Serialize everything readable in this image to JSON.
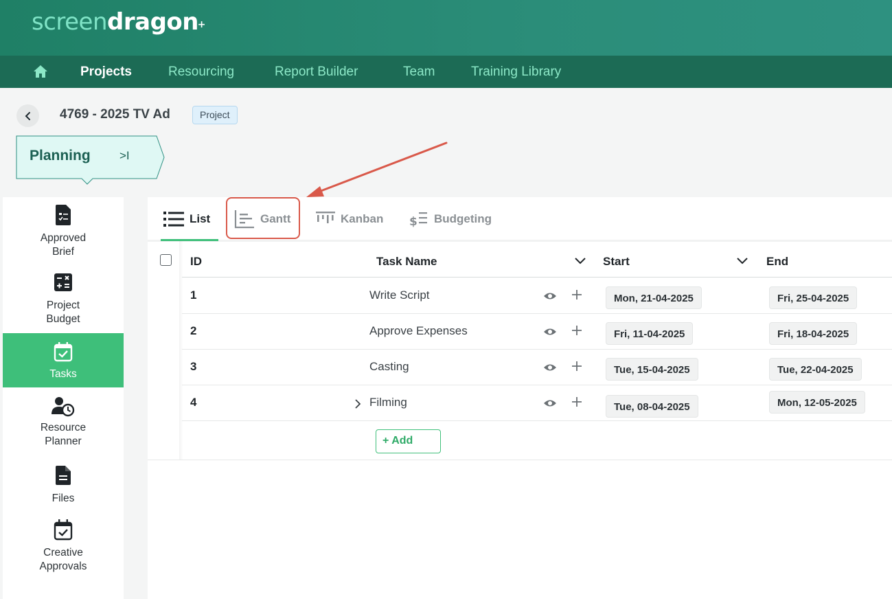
{
  "header": {
    "logo_part1": "screen",
    "logo_part2": "dragon",
    "logo_mark": "+"
  },
  "nav": {
    "home_icon": "home-icon",
    "items": [
      {
        "label": "Projects",
        "active": true
      },
      {
        "label": "Resourcing",
        "active": false
      },
      {
        "label": "Report Builder",
        "active": false
      },
      {
        "label": "Team",
        "active": false
      },
      {
        "label": "Training Library",
        "active": false
      }
    ]
  },
  "breadcrumb": {
    "back_icon": "chevron-left-icon",
    "title": "4769 - 2025 TV Ad",
    "badge": "Project"
  },
  "stage": {
    "label": "Planning",
    "collapse_glyph": ">I"
  },
  "sidebar": {
    "items": [
      {
        "label": "Approved\nBrief",
        "icon": "brief-icon",
        "active": false
      },
      {
        "label": "Project\nBudget",
        "icon": "calculator-icon",
        "active": false
      },
      {
        "label": "Tasks",
        "icon": "calendar-check-icon",
        "active": true
      },
      {
        "label": "Resource\nPlanner",
        "icon": "user-clock-icon",
        "active": false
      },
      {
        "label": "Files",
        "icon": "file-icon",
        "active": false
      },
      {
        "label": "Creative\nApprovals",
        "icon": "calendar-approval-icon",
        "active": false
      }
    ]
  },
  "tabs": [
    {
      "label": "List",
      "icon": "list-icon",
      "active": true
    },
    {
      "label": "Gantt",
      "icon": "gantt-icon",
      "active": false
    },
    {
      "label": "Kanban",
      "icon": "kanban-icon",
      "active": false
    },
    {
      "label": "Budgeting",
      "icon": "budgeting-icon",
      "active": false
    }
  ],
  "table": {
    "columns": {
      "id": "ID",
      "task_name": "Task Name",
      "start": "Start",
      "end": "End"
    },
    "rows": [
      {
        "id": "1",
        "name": "Write Script",
        "start": "Mon, 21-04-2025",
        "end": "Fri, 25-04-2025",
        "expandable": false
      },
      {
        "id": "2",
        "name": "Approve Expenses",
        "start": "Fri, 11-04-2025",
        "end": "Fri, 18-04-2025",
        "expandable": false
      },
      {
        "id": "3",
        "name": "Casting",
        "start": "Tue, 15-04-2025",
        "end": "Tue, 22-04-2025",
        "expandable": false
      },
      {
        "id": "4",
        "name": "Filming",
        "start": "Tue, 08-04-2025",
        "end": "Mon, 12-05-2025",
        "expandable": true
      }
    ],
    "add_label": "+ Add"
  },
  "colors": {
    "brand_green": "#3ebf7a",
    "header_teal": "#2b8d79",
    "nav_dark": "#1c6b55",
    "annotation_red": "#d9594a"
  }
}
